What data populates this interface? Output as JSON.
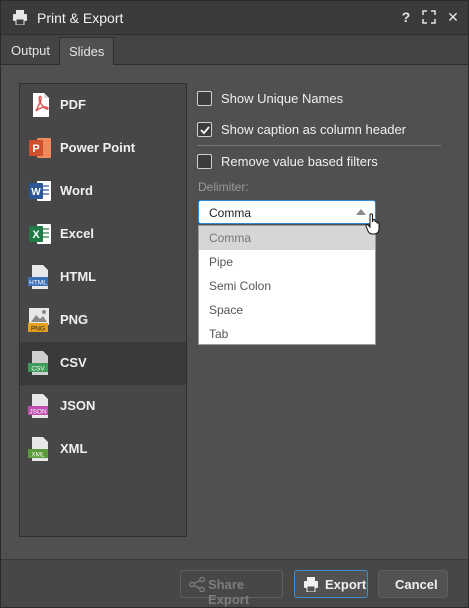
{
  "window": {
    "title": "Print & Export",
    "help_label": "?",
    "maximize_icon": "maximize-icon",
    "close_label": "✕"
  },
  "tabs": [
    {
      "label": "Output",
      "active": true
    },
    {
      "label": "Slides",
      "active": false
    }
  ],
  "formats": [
    {
      "label": "PDF",
      "icon": "pdf-icon",
      "selected": false
    },
    {
      "label": "Power Point",
      "icon": "powerpoint-icon",
      "selected": false
    },
    {
      "label": "Word",
      "icon": "word-icon",
      "selected": false
    },
    {
      "label": "Excel",
      "icon": "excel-icon",
      "selected": false
    },
    {
      "label": "HTML",
      "icon": "html-icon",
      "selected": false
    },
    {
      "label": "PNG",
      "icon": "png-icon",
      "selected": false
    },
    {
      "label": "CSV",
      "icon": "csv-icon",
      "selected": true
    },
    {
      "label": "JSON",
      "icon": "json-icon",
      "selected": false
    },
    {
      "label": "XML",
      "icon": "xml-icon",
      "selected": false
    }
  ],
  "options": {
    "show_unique_names": {
      "label": "Show Unique Names",
      "checked": false
    },
    "show_caption": {
      "label": "Show caption as column header",
      "checked": true
    },
    "remove_filters": {
      "label": "Remove value based filters",
      "checked": false
    }
  },
  "delimiter": {
    "label": "Delimiter:",
    "selected": "Comma",
    "options": [
      "Comma",
      "Pipe",
      "Semi Colon",
      "Space",
      "Tab"
    ],
    "highlighted": "Comma"
  },
  "footer": {
    "share_label": "Share Export",
    "share_enabled": false,
    "export_label": "Export",
    "cancel_label": "Cancel"
  },
  "colors": {
    "accent": "#2d8ad6",
    "pdf": "#d9534f",
    "powerpoint": "#d0502b",
    "word": "#2b5797",
    "excel": "#1f7a45",
    "png": "#e6a020",
    "csv": "#3e9b5a",
    "json": "#c04db0",
    "xml": "#5a9a3a"
  }
}
